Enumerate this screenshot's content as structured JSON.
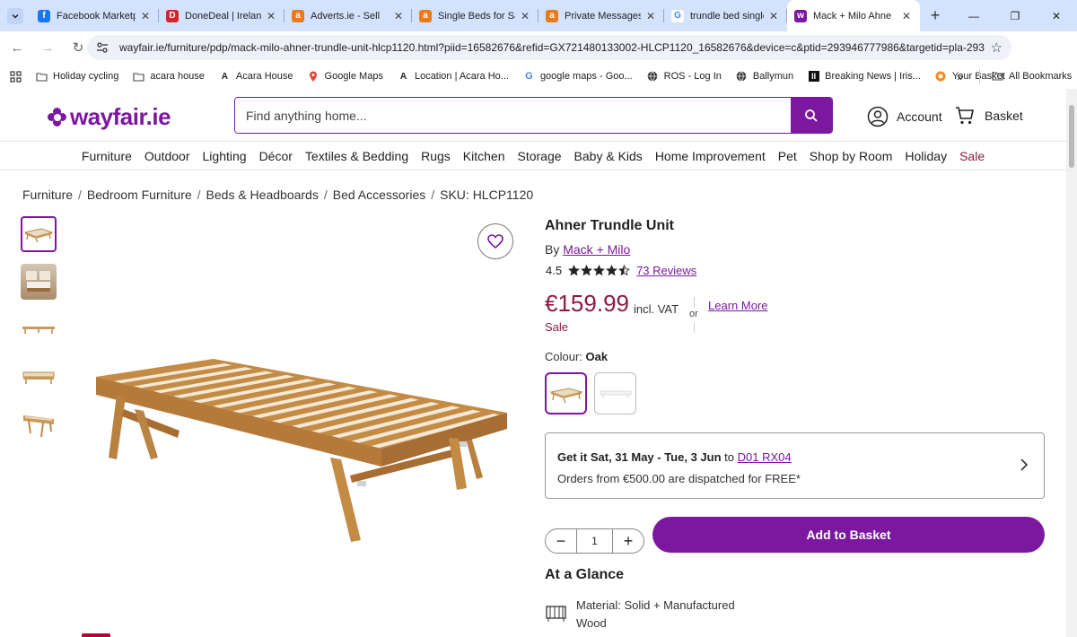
{
  "browser": {
    "tabs": [
      {
        "label": "Facebook Marketp",
        "icon": "facebook-icon",
        "color": "#1877f2",
        "glyph": "f"
      },
      {
        "label": "DoneDeal | Ireland",
        "icon": "donedeal-icon",
        "color": "#d8232a",
        "glyph": "D"
      },
      {
        "label": "Adverts.ie - Sell",
        "icon": "adverts-icon",
        "color": "#ec7a1c",
        "glyph": "a"
      },
      {
        "label": "Single Beds for Sa",
        "icon": "adverts-icon",
        "color": "#ec7a1c",
        "glyph": "a"
      },
      {
        "label": "Private Messages",
        "icon": "adverts-icon",
        "color": "#ec7a1c",
        "glyph": "a"
      },
      {
        "label": "trundle bed single",
        "icon": "google-icon",
        "color": "#4285f4",
        "glyph": "G"
      },
      {
        "label": "Mack + Milo Ahne",
        "icon": "wayfair-icon",
        "color": "#7b189f",
        "glyph": "w"
      }
    ],
    "url": "wayfair.ie/furniture/pdp/mack-milo-ahner-trundle-unit-hlcp1120.html?piid=16582676&refid=GX721480133002-HLCP1120_16582676&device=c&ptid=293946777986&targetid=pla-293...",
    "bookmarks": [
      {
        "label": "Holiday cycling",
        "icon": "folder-icon"
      },
      {
        "label": "acara house",
        "icon": "folder-icon"
      },
      {
        "label": "Acara House",
        "icon": "acara-icon"
      },
      {
        "label": "Google Maps",
        "icon": "maps-icon"
      },
      {
        "label": "Location | Acara Ho...",
        "icon": "acara-icon"
      },
      {
        "label": "google maps - Goo...",
        "icon": "google-icon"
      },
      {
        "label": "ROS - Log In",
        "icon": "globe-icon"
      },
      {
        "label": "Ballymun",
        "icon": "globe-icon"
      },
      {
        "label": "Breaking News | Iris...",
        "icon": "news-icon"
      },
      {
        "label": "Your Basket",
        "icon": "basket-bm-icon"
      }
    ],
    "bookmarks_more": "»",
    "all_bookmarks": "All Bookmarks"
  },
  "header": {
    "logo": "wayfair.ie",
    "search_placeholder": "Find anything home...",
    "account": "Account",
    "basket": "Basket"
  },
  "categories": [
    "Furniture",
    "Outdoor",
    "Lighting",
    "Décor",
    "Textiles & Bedding",
    "Rugs",
    "Kitchen",
    "Storage",
    "Baby & Kids",
    "Home Improvement",
    "Pet",
    "Shop by Room",
    "Holiday",
    "Sale"
  ],
  "breadcrumb": [
    "Furniture",
    "Bedroom Furniture",
    "Beds & Headboards",
    "Bed Accessories",
    "SKU: HLCP1120"
  ],
  "product": {
    "title": "Ahner Trundle Unit",
    "by": "By",
    "brand": "Mack + Milo",
    "rating": "4.5",
    "rating_value": 4.5,
    "reviews": "73 Reviews",
    "price": "€159.99",
    "incl_vat": "incl. VAT",
    "sale": "Sale",
    "or": "or",
    "learn_more": "Learn More",
    "colour_label": "Colour:",
    "colour_value": "Oak",
    "delivery_prefix": "Get it Sat, 31 May - Tue, 3 Jun",
    "delivery_to": "to",
    "delivery_code": "D01 RX04",
    "delivery_line2": "Orders from €500.00 are dispatched for FREE*",
    "quantity": "1",
    "add_to_basket": "Add to Basket",
    "at_a_glance": "At a Glance",
    "material": "Material: Solid + Manufactured Wood"
  },
  "colors": {
    "brand": "#7b189f",
    "sale": "#8b1c3f"
  }
}
